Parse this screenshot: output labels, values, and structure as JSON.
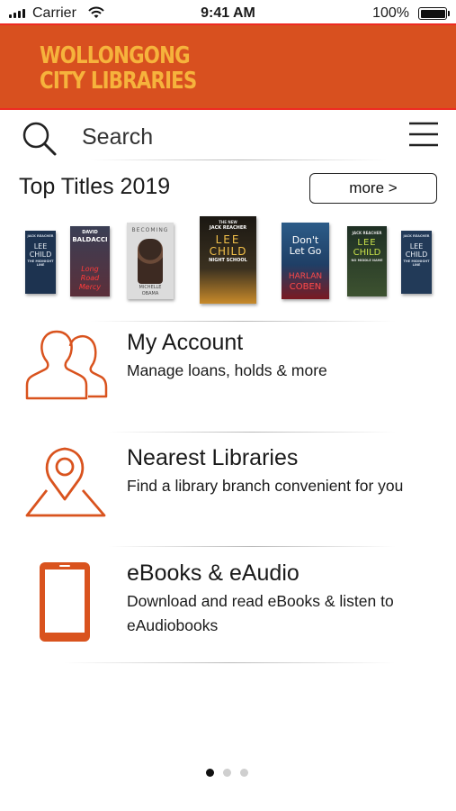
{
  "status_bar": {
    "carrier": "Carrier",
    "time": "9:41 AM",
    "battery": "100%"
  },
  "header": {
    "logo_line1": "WOLLONGONG",
    "logo_line2": "CITY LIBRARIES"
  },
  "search": {
    "label": "Search"
  },
  "top_titles": {
    "heading": "Top Titles 2019",
    "more_label": "more >",
    "books": [
      {
        "cover_text": [
          "JACK REACHER",
          "LEE",
          "CHILD",
          "THE MIDNIGHT LINE"
        ],
        "bg": "#1d3350"
      },
      {
        "cover_text": [
          "DAVID",
          "BALDACCI",
          "Long",
          "Road",
          "Mercy"
        ],
        "bg": "#4a3b45"
      },
      {
        "cover_text": [
          "BECOMING",
          "MICHELLE",
          "OBAMA"
        ],
        "bg": "#d9d9d9"
      },
      {
        "cover_text": [
          "THE NEW",
          "JACK REACHER",
          "LEE",
          "CHILD",
          "NIGHT SCHOOL"
        ],
        "bg": "#2a2418"
      },
      {
        "cover_text": [
          "Don't",
          "Let Go",
          "HARLAN",
          "COBEN"
        ],
        "bg": "#2c5c88"
      },
      {
        "cover_text": [
          "JACK REACHER",
          "LEE",
          "CHILD",
          "NO MIDDLE NAME"
        ],
        "bg": "#1e2f24"
      },
      {
        "cover_text": [
          "JACK REACHER",
          "LEE",
          "CHILD",
          "THE MIDNIGHT LINE"
        ],
        "bg": "#223a58"
      }
    ]
  },
  "menu": [
    {
      "title": "My Account",
      "subtitle": "Manage loans, holds & more",
      "icon": "users-icon"
    },
    {
      "title": "Nearest Libraries",
      "subtitle": "Find a library branch convenient for you",
      "icon": "map-pin-icon"
    },
    {
      "title": "eBooks & eAudio",
      "subtitle": "Download and read eBooks & listen to eAudiobooks",
      "icon": "tablet-icon"
    }
  ],
  "pager": {
    "pages": 3,
    "active": 1
  },
  "colors": {
    "header_bg": "#d8501f",
    "header_border": "#ee2a22",
    "logo": "#f6b33c",
    "icon_orange": "#d9531e"
  }
}
